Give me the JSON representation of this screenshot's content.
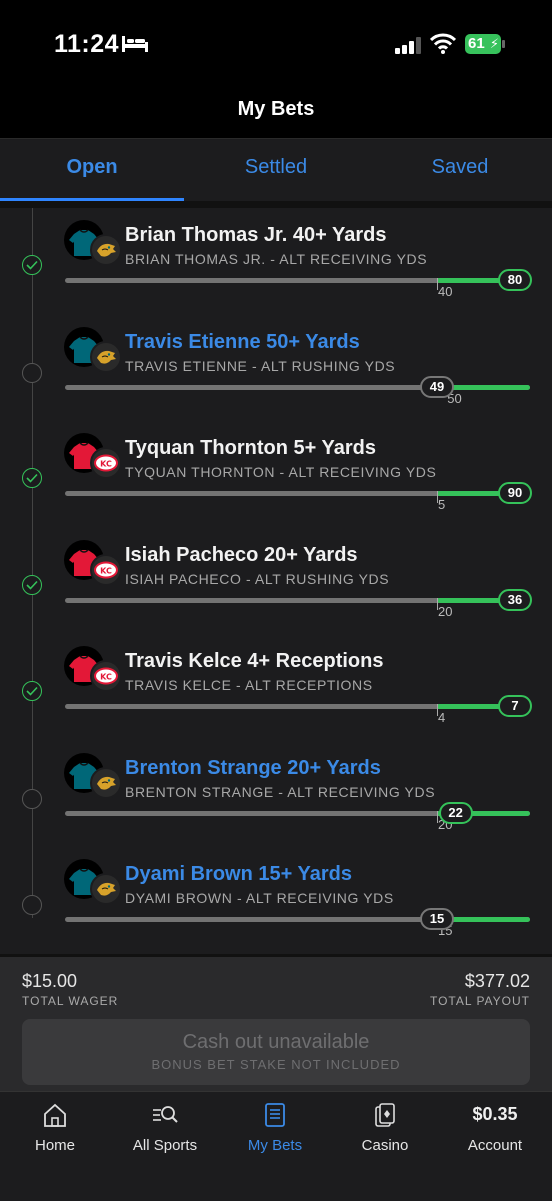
{
  "status": {
    "time": "11:24",
    "battery": "61"
  },
  "header": {
    "title": "My Bets"
  },
  "tabs": [
    {
      "label": "Open"
    },
    {
      "label": "Settled"
    },
    {
      "label": "Saved"
    }
  ],
  "legs": [
    {
      "title": "Brian Thomas Jr. 40+ Yards",
      "subtitle": "BRIAN THOMAS JR. - ALT RECEIVING YDS",
      "target": "40",
      "value": "80",
      "status": "won",
      "team": "JAX",
      "progress_fraction": 1.0,
      "target_fraction": 0.8
    },
    {
      "title": "Travis Etienne 50+ Yards",
      "subtitle": "TRAVIS ETIENNE - ALT RUSHING YDS",
      "target": "50",
      "value": "49",
      "status": "pending",
      "team": "JAX",
      "progress_fraction": 0.8,
      "target_fraction": 0.82
    },
    {
      "title": "Tyquan Thornton 5+ Yards",
      "subtitle": "TYQUAN THORNTON - ALT RECEIVING YDS",
      "target": "5",
      "value": "90",
      "status": "won",
      "team": "KC",
      "progress_fraction": 1.0,
      "target_fraction": 0.8
    },
    {
      "title": "Isiah Pacheco 20+ Yards",
      "subtitle": "ISIAH PACHECO - ALT RUSHING YDS",
      "target": "20",
      "value": "36",
      "status": "won",
      "team": "KC",
      "progress_fraction": 1.0,
      "target_fraction": 0.8
    },
    {
      "title": "Travis Kelce 4+ Receptions",
      "subtitle": "TRAVIS KELCE - ALT RECEPTIONS",
      "target": "4",
      "value": "7",
      "status": "won",
      "team": "KC",
      "progress_fraction": 1.0,
      "target_fraction": 0.8
    },
    {
      "title": "Brenton Strange 20+ Yards",
      "subtitle": "BRENTON STRANGE - ALT RECEIVING YDS",
      "target": "20",
      "value": "22",
      "status": "pending",
      "team": "JAX",
      "progress_fraction": 0.84,
      "target_fraction": 0.8
    },
    {
      "title": "Dyami Brown 15+ Yards",
      "subtitle": "DYAMI BROWN - ALT RECEIVING YDS",
      "target": "15",
      "value": "15",
      "status": "pending",
      "team": "JAX",
      "progress_fraction": 0.8,
      "target_fraction": 0.8
    }
  ],
  "summary": {
    "wager_amount": "$15.00",
    "wager_label": "TOTAL WAGER",
    "payout_amount": "$377.02",
    "payout_label": "TOTAL PAYOUT",
    "cashout_title": "Cash out unavailable",
    "cashout_sub": "BONUS BET STAKE NOT INCLUDED"
  },
  "nav": [
    {
      "label": "Home",
      "icon": "home-icon"
    },
    {
      "label": "All Sports",
      "icon": "search-sports-icon"
    },
    {
      "label": "My Bets",
      "icon": "bet-slip-icon"
    },
    {
      "label": "Casino",
      "icon": "cards-icon"
    },
    {
      "label": "Account",
      "balance": "$0.35"
    }
  ],
  "colors": {
    "accent": "#3b8ae6",
    "win": "#35c25a",
    "jax": "#006778",
    "kc": "#e31837"
  }
}
